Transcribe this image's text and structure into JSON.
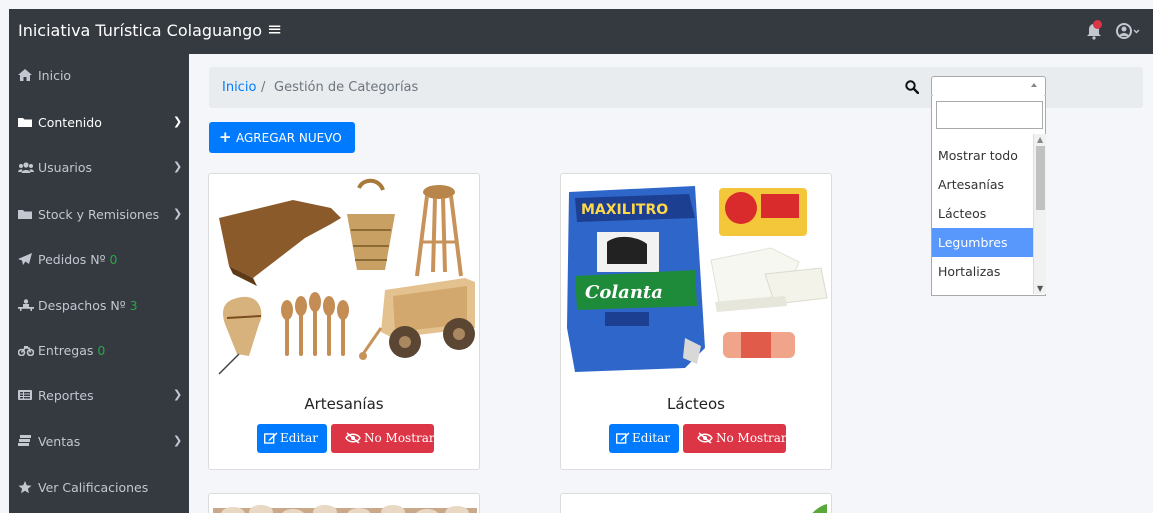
{
  "app": {
    "title": "Iniciativa Turística Colaguango",
    "menu_icon": "hamburger-icon",
    "notification_icon": "bell-icon",
    "user_icon": "user-circle-icon"
  },
  "sidebar": {
    "items": [
      {
        "label": "Inicio",
        "icon": "home-icon",
        "has_arrow": false
      },
      {
        "label": "Contenido",
        "icon": "folder-icon",
        "has_arrow": true
      },
      {
        "label": "Usuarios",
        "icon": "users-icon",
        "has_arrow": true
      },
      {
        "label": "Stock y Remisiones",
        "icon": "folder-icon",
        "has_arrow": true
      },
      {
        "label": "Pedidos Nº",
        "count": "0",
        "icon": "send-icon",
        "has_arrow": false
      },
      {
        "label": "Despachos Nº",
        "count": "3",
        "icon": "dispatch-icon",
        "has_arrow": false
      },
      {
        "label": "Entregas",
        "count": "0",
        "icon": "motorcycle-icon",
        "has_arrow": false
      },
      {
        "label": "Reportes",
        "icon": "table-icon",
        "has_arrow": true
      },
      {
        "label": "Ventas",
        "icon": "cash-icon",
        "has_arrow": true
      },
      {
        "label": "Ver Calificaciones",
        "icon": "star-icon",
        "has_arrow": false
      }
    ]
  },
  "breadcrumb": {
    "home": "Inicio",
    "separator": "/",
    "current": "Gestión de Categorías"
  },
  "filter": {
    "search_icon": "search-icon",
    "selected_value": "",
    "search_value": "",
    "options": [
      "Mostrar todo",
      "Artesanías",
      "Lácteos",
      "Legumbres",
      "Hortalizas"
    ],
    "highlighted": "Legumbres"
  },
  "add_button": {
    "label": "AGREGAR NUEVO",
    "icon": "plus-icon"
  },
  "categories": [
    {
      "name": "Artesanías",
      "edit_label": "Editar",
      "hide_label": "No Mostrar"
    },
    {
      "name": "Lácteos",
      "edit_label": "Editar",
      "hide_label": "No Mostrar"
    }
  ],
  "colors": {
    "navbar": "#343a40",
    "primary": "#007bff",
    "danger": "#dc3545",
    "success": "#28a745",
    "select_highlight": "#5897fb"
  }
}
